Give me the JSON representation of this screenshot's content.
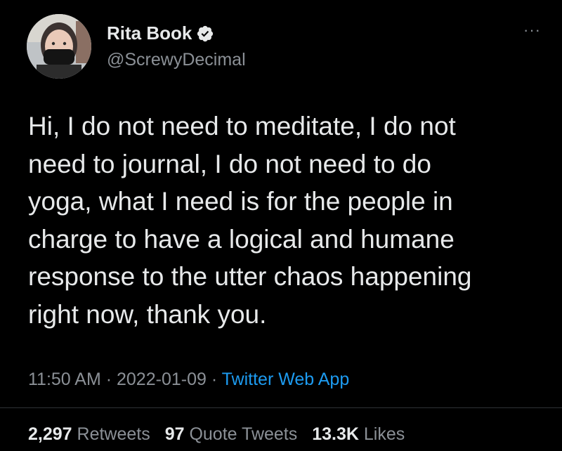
{
  "user": {
    "display_name": "Rita Book",
    "handle": "@ScrewyDecimal",
    "verified_icon": "verified-badge-icon",
    "accent_color": "#1d9bf0"
  },
  "more_icon": "···",
  "tweet": {
    "text": "Hi, I do not need to meditate, I do not\nneed to journal, I do not need to do\nyoga, what I need is for the people in\ncharge to have a logical and humane\nresponse to the utter chaos happening\nright now, thank you."
  },
  "meta": {
    "time": "11:50 AM",
    "sep1": " · ",
    "date": "2022-01-09",
    "sep2": " · ",
    "app": "Twitter Web App"
  },
  "stats": {
    "retweets_count": "2,297",
    "retweets_label": "Retweets",
    "quotes_count": "97",
    "quotes_label": "Quote Tweets",
    "likes_count": "13.3K",
    "likes_label": "Likes"
  }
}
